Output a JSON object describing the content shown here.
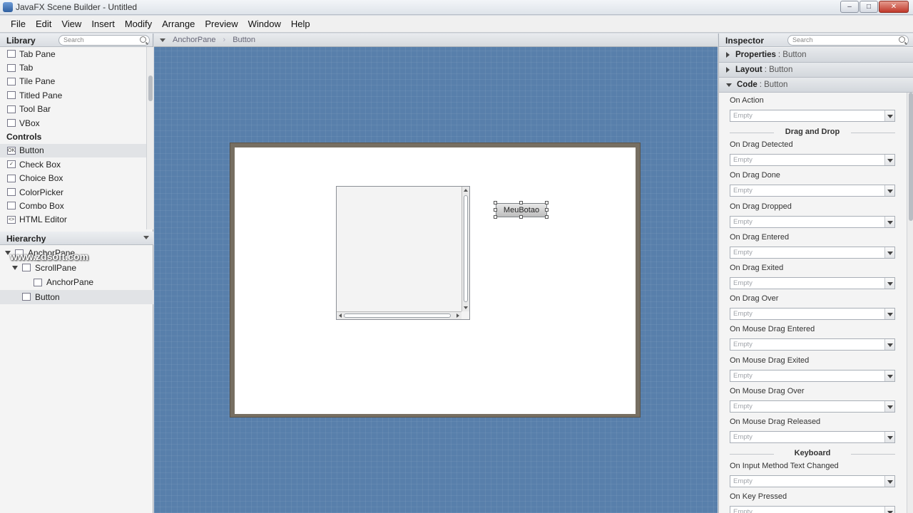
{
  "window": {
    "title": "JavaFX Scene Builder - Untitled",
    "minimize_glyph": "–",
    "maximize_glyph": "□",
    "close_glyph": "✕"
  },
  "menu": [
    "File",
    "Edit",
    "View",
    "Insert",
    "Modify",
    "Arrange",
    "Preview",
    "Window",
    "Help"
  ],
  "library": {
    "title": "Library",
    "search_placeholder": "Search",
    "items": [
      {
        "label": "Tab Pane",
        "icon": "tab-pane-icon",
        "glyph": ""
      },
      {
        "label": "Tab",
        "icon": "tab-icon",
        "glyph": ""
      },
      {
        "label": "Tile Pane",
        "icon": "tile-pane-icon",
        "glyph": ""
      },
      {
        "label": "Titled Pane",
        "icon": "titled-pane-icon",
        "glyph": ""
      },
      {
        "label": "Tool Bar",
        "icon": "tool-bar-icon",
        "glyph": ""
      },
      {
        "label": "VBox",
        "icon": "vbox-icon",
        "glyph": ""
      }
    ],
    "category": "Controls",
    "controls": [
      {
        "label": "Button",
        "icon": "button-icon",
        "glyph": "OK",
        "selected": true
      },
      {
        "label": "Check Box",
        "icon": "check-box-icon",
        "glyph": "✓",
        "selected": false
      },
      {
        "label": "Choice Box",
        "icon": "choice-box-icon",
        "glyph": "",
        "selected": false
      },
      {
        "label": "ColorPicker",
        "icon": "color-picker-icon",
        "glyph": "",
        "selected": false
      },
      {
        "label": "Combo Box",
        "icon": "combo-box-icon",
        "glyph": "",
        "selected": false
      },
      {
        "label": "HTML Editor",
        "icon": "html-editor-icon",
        "glyph": "<>",
        "selected": false
      }
    ]
  },
  "hierarchy": {
    "title": "Hierarchy",
    "nodes": [
      {
        "label": "AnchorPane",
        "level": 0,
        "expanded": true,
        "icon": "anchor-pane-icon",
        "selected": false
      },
      {
        "label": "ScrollPane",
        "level": 1,
        "expanded": true,
        "icon": "scroll-pane-icon",
        "selected": false
      },
      {
        "label": "AnchorPane",
        "level": 2,
        "expanded": false,
        "icon": "anchor-pane-icon",
        "selected": false
      },
      {
        "label": "Button",
        "level": 1,
        "expanded": false,
        "icon": "button-icon",
        "selected": true
      }
    ],
    "watermark": "www.zdsoft.com"
  },
  "breadcrumb": [
    "AnchorPane",
    "Button"
  ],
  "canvas": {
    "button_label": "MeuBotao"
  },
  "inspector": {
    "title": "Inspector",
    "search_placeholder": "Search",
    "sections": [
      {
        "name": "Properties",
        "target": ": Button",
        "expanded": false
      },
      {
        "name": "Layout",
        "target": ": Button",
        "expanded": false
      },
      {
        "name": "Code",
        "target": ": Button",
        "expanded": true
      }
    ],
    "empty_text": "Empty",
    "fields": [
      {
        "type": "field",
        "label": "On Action"
      },
      {
        "type": "group",
        "label": "Drag and Drop"
      },
      {
        "type": "field",
        "label": "On Drag Detected"
      },
      {
        "type": "field",
        "label": "On Drag Done"
      },
      {
        "type": "field",
        "label": "On Drag Dropped"
      },
      {
        "type": "field",
        "label": "On Drag Entered"
      },
      {
        "type": "field",
        "label": "On Drag Exited"
      },
      {
        "type": "field",
        "label": "On Drag Over"
      },
      {
        "type": "field",
        "label": "On Mouse Drag Entered"
      },
      {
        "type": "field",
        "label": "On Mouse Drag Exited"
      },
      {
        "type": "field",
        "label": "On Mouse Drag Over"
      },
      {
        "type": "field",
        "label": "On Mouse Drag Released"
      },
      {
        "type": "group",
        "label": "Keyboard"
      },
      {
        "type": "field",
        "label": "On Input Method Text Changed"
      },
      {
        "type": "field",
        "label": "On Key Pressed"
      }
    ]
  },
  "colors": {
    "canvas_bg": "#587fab",
    "stage_frame": "#776f62",
    "stage_bg": "#ffffff"
  }
}
